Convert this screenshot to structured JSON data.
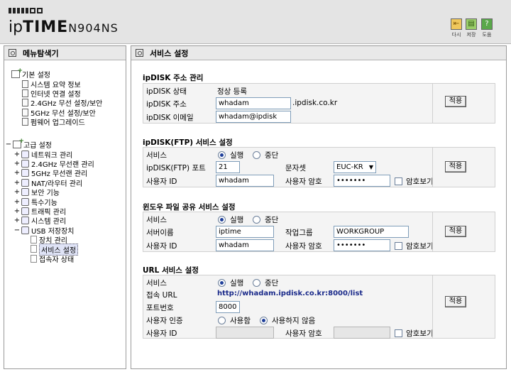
{
  "header": {
    "brand_prefix": "ip",
    "brand_main": "TIME",
    "model": "N904NS",
    "buttons": [
      {
        "name": "logout",
        "label": "다시",
        "icon": "exit-icon"
      },
      {
        "name": "save",
        "label": "저장",
        "icon": "save-icon"
      },
      {
        "name": "help",
        "label": "도움",
        "icon": "help-icon"
      }
    ]
  },
  "sidebar": {
    "title": "메뉴탐색기",
    "basic": {
      "label": "기본 설정",
      "items": [
        "시스템 요약 정보",
        "인터넷 연결 설정",
        "2.4GHz 무선 설정/보안",
        "5GHz 무선 설정/보안",
        "펌웨어 업그레이드"
      ]
    },
    "advanced": {
      "label": "고급 설정",
      "items": [
        "네트워크 관리",
        "2.4GHz 무선랜 관리",
        "5GHz 무선랜 관리",
        "NAT/라우터 관리",
        "보안 기능",
        "특수기능",
        "트래픽 관리",
        "시스템 관리",
        "USB 저장장치"
      ],
      "usb_items": [
        "장치 관리",
        "서비스 설정",
        "접속자 상태"
      ],
      "selected": "서비스 설정"
    }
  },
  "main": {
    "title": "서비스 설정",
    "apply_label": "적용",
    "ipdisk": {
      "title": "ipDISK 주소 관리",
      "status_label": "ipDISK 상태",
      "status_value": "정상 등록",
      "address_label": "ipDISK 주소",
      "address_value": "whadam",
      "address_suffix": ".ipdisk.co.kr",
      "email_label": "ipDISK 이메일",
      "email_value": "whadam@ipdisk"
    },
    "ftp": {
      "title": "ipDISK(FTP) 서비스 설정",
      "service_label": "서비스",
      "on_label": "실행",
      "off_label": "중단",
      "port_label": "ipDISK(FTP) 포트",
      "port_value": "21",
      "charset_label": "문자셋",
      "charset_value": "EUC-KR",
      "user_label": "사용자 ID",
      "user_value": "whadam",
      "pw_label": "사용자 암호",
      "pw_value": "•••••••",
      "show_pw_label": "암호보기"
    },
    "smb": {
      "title": "윈도우 파일 공유 서비스 설정",
      "service_label": "서비스",
      "on_label": "실행",
      "off_label": "중단",
      "server_label": "서버이름",
      "server_value": "iptime",
      "workgroup_label": "작업그룹",
      "workgroup_value": "WORKGROUP",
      "user_label": "사용자 ID",
      "user_value": "whadam",
      "pw_label": "사용자 암호",
      "pw_value": "•••••••",
      "show_pw_label": "암호보기"
    },
    "url": {
      "title": "URL 서비스 설정",
      "service_label": "서비스",
      "on_label": "실행",
      "off_label": "중단",
      "access_label": "접속 URL",
      "access_value": "http://whadam.ipdisk.co.kr:8000/list",
      "port_label": "포트번호",
      "port_value": "8000",
      "auth_label": "사용자 인증",
      "auth_use_label": "사용함",
      "auth_nouse_label": "사용하지 않음",
      "user_label": "사용자 ID",
      "user_value": "",
      "pw_label": "사용자 암호",
      "pw_value": "",
      "show_pw_label": "암호보기"
    }
  }
}
